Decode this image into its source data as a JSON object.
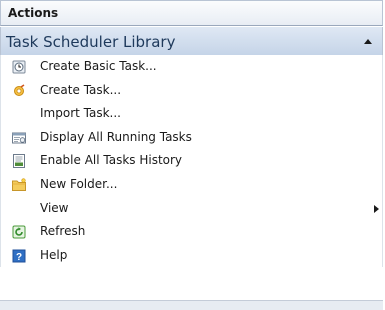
{
  "pane": {
    "title": "Actions"
  },
  "section": {
    "title": "Task Scheduler Library",
    "collapse_icon": "chevron-up-icon"
  },
  "items": [
    {
      "label": "Create Basic Task...",
      "icon": "clock-wizard-icon"
    },
    {
      "label": "Create Task...",
      "icon": "task-gear-icon"
    },
    {
      "label": "Import Task...",
      "icon": ""
    },
    {
      "label": "Display All Running Tasks",
      "icon": "running-tasks-icon"
    },
    {
      "label": "Enable All Tasks History",
      "icon": "history-icon"
    },
    {
      "label": "New Folder...",
      "icon": "folder-icon"
    },
    {
      "label": "View",
      "icon": "",
      "submenu": true
    },
    {
      "label": "Refresh",
      "icon": "refresh-icon"
    },
    {
      "label": "Help",
      "icon": "help-icon"
    }
  ],
  "colors": {
    "section_header": "#c5d4e8",
    "section_text": "#1e395b"
  }
}
